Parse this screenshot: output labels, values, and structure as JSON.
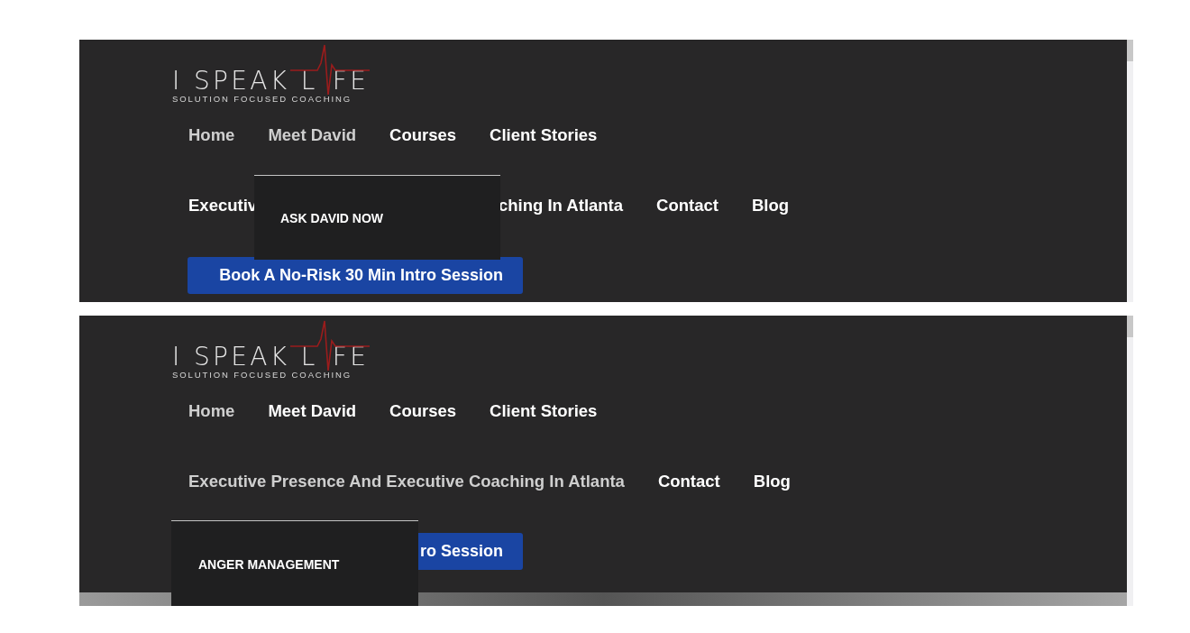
{
  "panels": [
    {
      "logo": {
        "title_left": "I SPEAK L",
        "title_right": "FE",
        "tagline": "SOLUTION FOCUSED COACHING"
      },
      "nav_rows": [
        [
          {
            "label": "Home",
            "muted": true,
            "kind": "link"
          },
          {
            "label": "Meet David",
            "muted": true,
            "kind": "link"
          },
          {
            "label": "Courses",
            "muted": false,
            "kind": "link"
          },
          {
            "label": "Client Stories",
            "muted": false,
            "kind": "link"
          }
        ],
        [
          {
            "label": "Executiv",
            "muted": false,
            "kind": "covered_end"
          },
          {
            "label": "ching In Atlanta",
            "muted": false,
            "kind": "link"
          },
          {
            "label": "Contact",
            "muted": false,
            "kind": "link"
          },
          {
            "label": "Blog",
            "muted": false,
            "kind": "link"
          }
        ]
      ],
      "cta": "Book A No-Risk 30 Min Intro Session",
      "dropdown": {
        "items": [
          "ASK DAVID NOW"
        ]
      },
      "section_below": false
    },
    {
      "logo": {
        "title_left": "I SPEAK L",
        "title_right": "FE",
        "tagline": "SOLUTION FOCUSED COACHING"
      },
      "nav_rows": [
        [
          {
            "label": "Home",
            "muted": true,
            "kind": "link"
          },
          {
            "label": "Meet David",
            "muted": false,
            "kind": "link"
          },
          {
            "label": "Courses",
            "muted": false,
            "kind": "link"
          },
          {
            "label": "Client Stories",
            "muted": false,
            "kind": "link"
          }
        ],
        [
          {
            "label": "Executive Presence And Executive Coaching In Atlanta",
            "muted": true,
            "kind": "link"
          },
          {
            "label": "Contact",
            "muted": false,
            "kind": "link"
          },
          {
            "label": "Blog",
            "muted": false,
            "kind": "link"
          }
        ]
      ],
      "cta": "ro Session",
      "dropdown": {
        "items": [
          "ANGER MANAGEMENT"
        ]
      },
      "section_below": true
    }
  ]
}
